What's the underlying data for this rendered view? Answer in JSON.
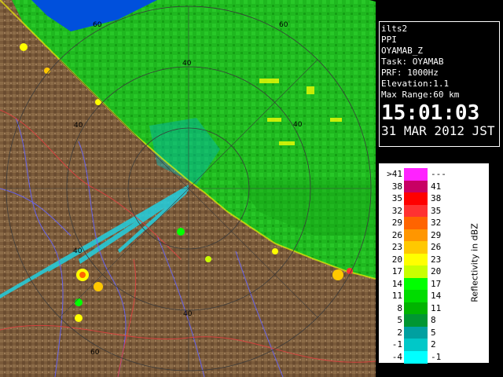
{
  "info": {
    "site": "ilts2",
    "product": "PPI",
    "volume": "OYAMAB_Z",
    "task": "Task: OYAMAB",
    "prf": "PRF: 1000Hz",
    "elevation": "Elevation:1.1",
    "max_range": "Max Range:60 km",
    "time": "15:01:03",
    "date": "31 MAR 2012 JST"
  },
  "legend": {
    "title": "Reflectivity in dBZ",
    "rows": [
      {
        "lo": ">41",
        "hi": "---",
        "color": "#ff22ff"
      },
      {
        "lo": "38",
        "hi": "41",
        "color": "#c80064"
      },
      {
        "lo": "35",
        "hi": "38",
        "color": "#ff0000"
      },
      {
        "lo": "32",
        "hi": "35",
        "color": "#ff3232"
      },
      {
        "lo": "29",
        "hi": "32",
        "color": "#ff6400"
      },
      {
        "lo": "26",
        "hi": "29",
        "color": "#ff9600"
      },
      {
        "lo": "23",
        "hi": "26",
        "color": "#ffc800"
      },
      {
        "lo": "20",
        "hi": "23",
        "color": "#ffff00"
      },
      {
        "lo": "17",
        "hi": "20",
        "color": "#c8ff00"
      },
      {
        "lo": "14",
        "hi": "17",
        "color": "#00ff00"
      },
      {
        "lo": "11",
        "hi": "14",
        "color": "#00dc00"
      },
      {
        "lo": "8",
        "hi": "11",
        "color": "#00b400"
      },
      {
        "lo": "5",
        "hi": "8",
        "color": "#009632"
      },
      {
        "lo": "2",
        "hi": "5",
        "color": "#00a0a0"
      },
      {
        "lo": "-1",
        "hi": "2",
        "color": "#00c8c8"
      },
      {
        "lo": "-4",
        "hi": "-1",
        "color": "#00ffff"
      }
    ]
  },
  "range_labels": [
    "40",
    "60",
    "40",
    "60",
    "40",
    "40",
    "40",
    "60"
  ],
  "colors": {
    "land": "#7a5c3c",
    "sea_echo": "#22c022",
    "weak_echo": "#00b4b4",
    "river": "#5a5aff",
    "border": "#ff5050"
  }
}
